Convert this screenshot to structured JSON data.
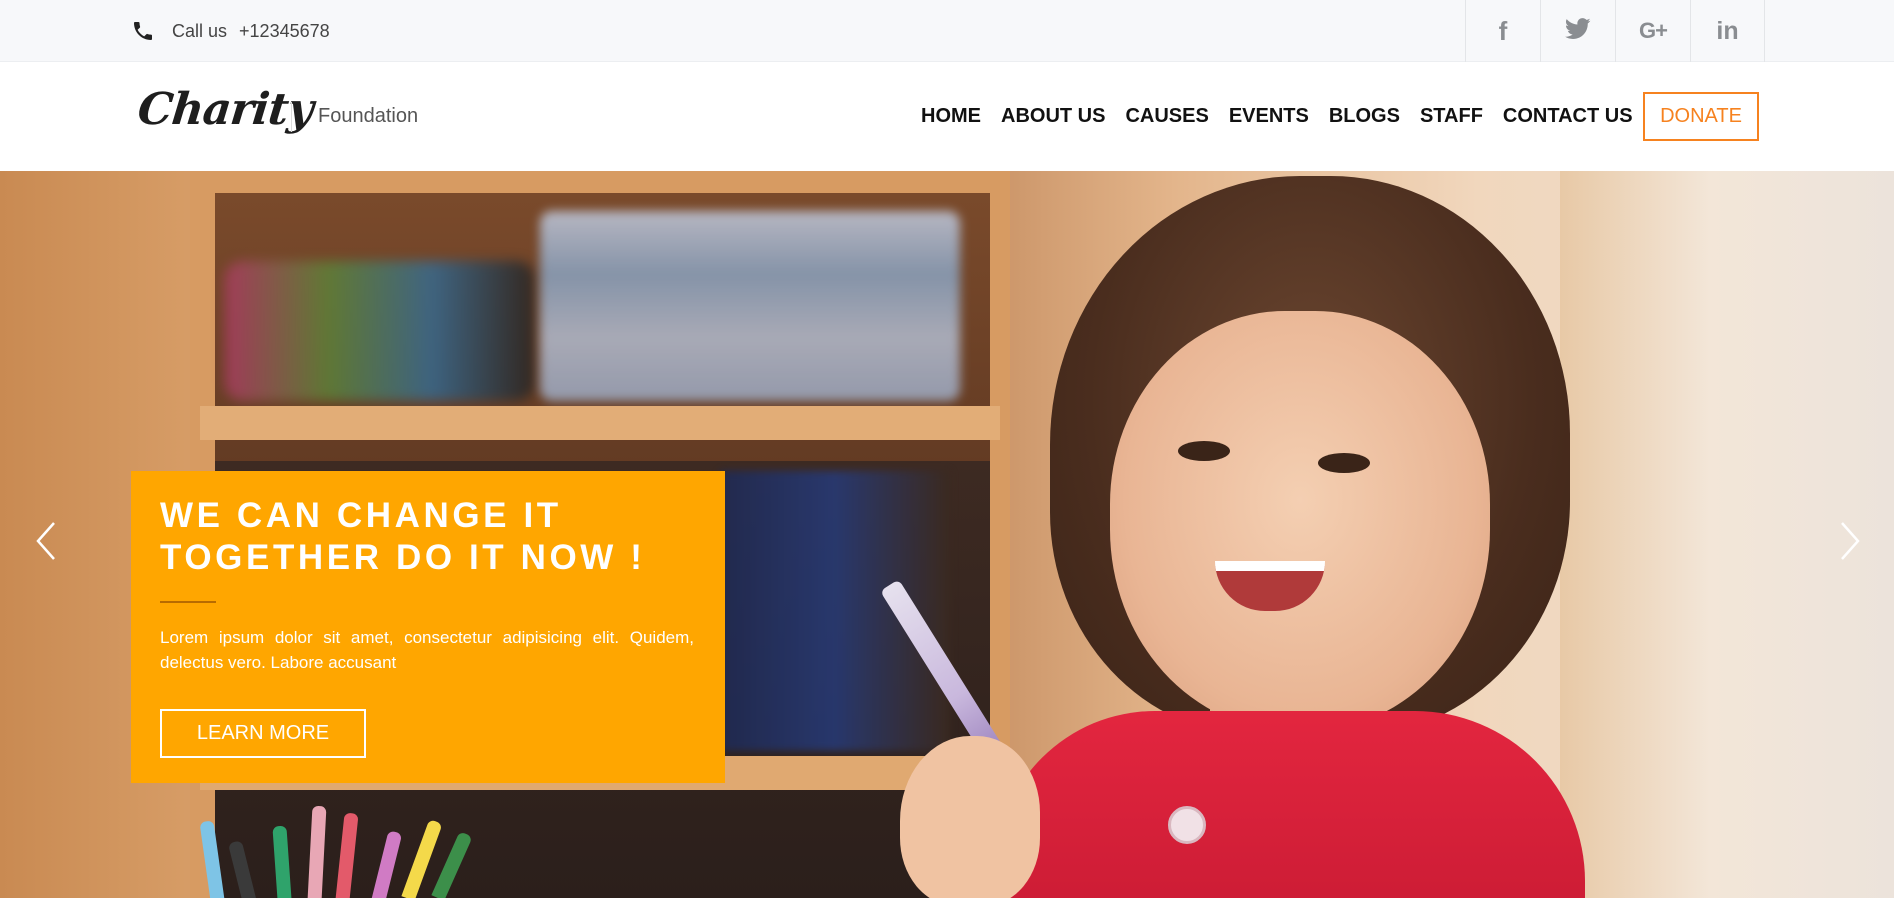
{
  "topbar": {
    "call_label": "Call us",
    "phone_number": "+12345678",
    "phone_icon": "phone-icon",
    "social": [
      {
        "name": "facebook-icon",
        "glyph": "f"
      },
      {
        "name": "twitter-icon",
        "glyph": ""
      },
      {
        "name": "google-plus-icon",
        "glyph": "G+"
      },
      {
        "name": "linkedin-icon",
        "glyph": "in"
      }
    ]
  },
  "header": {
    "logo": "Charity",
    "tagline": "Foundation",
    "nav": [
      "HOME",
      "ABOUT US",
      "CAUSES",
      "EVENTS",
      "BLOGS",
      "STAFF",
      "CONTACT US"
    ],
    "donate_label": "DONATE",
    "accent_color": "#f6821f"
  },
  "hero": {
    "title_line1": "WE CAN CHANGE IT",
    "title_line2": "TOGETHER DO IT NOW !",
    "text": "Lorem ipsum dolor sit amet, consectetur adipisicing elit. Quidem, delectus vero. Labore accusant",
    "button_label": "LEARN MORE",
    "caption_color": "#ffa600",
    "prev_icon": "chevron-left-icon",
    "next_icon": "chevron-right-icon"
  }
}
